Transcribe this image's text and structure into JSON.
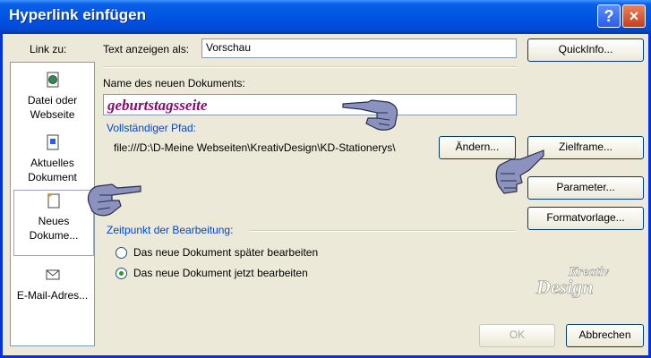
{
  "window": {
    "title": "Hyperlink einfügen",
    "help_button": "?",
    "close_button": "×"
  },
  "left_panel": {
    "heading": "Link zu:",
    "items": [
      {
        "line1": "Datei oder",
        "line2": "Webseite"
      },
      {
        "line1": "Aktuelles",
        "line2": "Dokument"
      },
      {
        "line1": "Neues",
        "line2": "Dokume..."
      },
      {
        "line1": "E-Mail-Adres...",
        "line2": ""
      }
    ]
  },
  "form": {
    "text_label": "Text anzeigen als:",
    "text_value": "Vorschau",
    "quickinfo_button": "QuickInfo...",
    "name_label": "Name des neuen Dokuments:",
    "name_value": "geburtstagsseite",
    "path_label": "Vollständiger Pfad:",
    "path_value": "file:///D:\\D-Meine Webseiten\\KreativDesign\\KD-Stationerys\\",
    "change_button": "Ändern...",
    "target_button": "Zielframe...",
    "parameter_button": "Parameter...",
    "style_button": "Formatvorlage...",
    "edit_group_label": "Zeitpunkt der Bearbeitung:",
    "options": [
      {
        "label": "Das neue Dokument später bearbeiten",
        "selected": false
      },
      {
        "label": "Das neue Dokument jetzt bearbeiten",
        "selected": true
      }
    ]
  },
  "footer": {
    "ok_button": "OK",
    "cancel_button": "Abbrechen"
  },
  "logo": {
    "line1": "Kreativ",
    "line2": "Design"
  },
  "colors": {
    "titlebar": "#0054e3",
    "group_label": "#0046d5",
    "name_text": "#8b0a6e"
  }
}
